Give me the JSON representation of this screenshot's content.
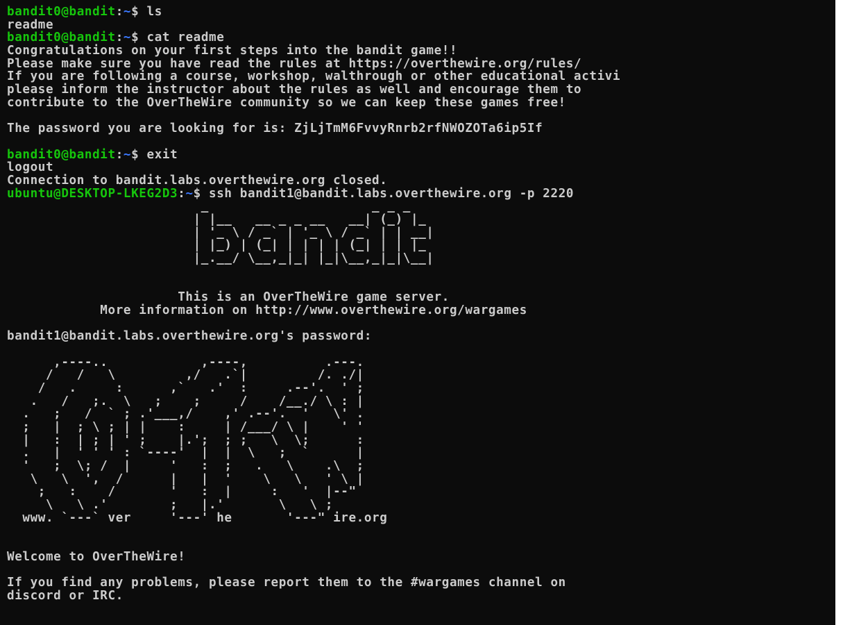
{
  "colors": {
    "background": "#0c0c0c",
    "text": "#cccccc",
    "prompt_user": "#16c60c",
    "prompt_path": "#3b78ff"
  },
  "session": [
    {
      "type": "prompt",
      "user": "bandit0@bandit",
      "sep": ":",
      "path": "~",
      "sign": "$",
      "cmd": " ls"
    },
    {
      "type": "text",
      "text": "readme"
    },
    {
      "type": "prompt",
      "user": "bandit0@bandit",
      "sep": ":",
      "path": "~",
      "sign": "$",
      "cmd": " cat readme"
    },
    {
      "type": "text",
      "text": "Congratulations on your first steps into the bandit game!!"
    },
    {
      "type": "text",
      "text": "Please make sure you have read the rules at https://overthewire.org/rules/"
    },
    {
      "type": "text",
      "text": "If you are following a course, workshop, walthrough or other educational activi"
    },
    {
      "type": "text",
      "text": "please inform the instructor about the rules as well and encourage them to"
    },
    {
      "type": "text",
      "text": "contribute to the OverTheWire community so we can keep these games free!"
    },
    {
      "type": "blank"
    },
    {
      "type": "text",
      "text": "The password you are looking for is: ZjLjTmM6FvvyRnrb2rfNWOZOTa6ip5If"
    },
    {
      "type": "blank"
    },
    {
      "type": "prompt",
      "user": "bandit0@bandit",
      "sep": ":",
      "path": "~",
      "sign": "$",
      "cmd": " exit"
    },
    {
      "type": "text",
      "text": "logout"
    },
    {
      "type": "text",
      "text": "Connection to bandit.labs.overthewire.org closed."
    },
    {
      "type": "prompt",
      "user": "ubuntu@DESKTOP-LKEG2D3",
      "sep": ":",
      "path": "~",
      "sign": "$",
      "cmd": " ssh bandit1@bandit.labs.overthewire.org -p 2220"
    },
    {
      "type": "art",
      "text": "                         _                     _ _ _"
    },
    {
      "type": "art",
      "text": "                        | |__   __ _ _ __   __| (_) |_"
    },
    {
      "type": "art",
      "text": "                        | '_ \\ / _` | '_ \\ / _` | | __|"
    },
    {
      "type": "art",
      "text": "                        | |_) | (_| | | | | (_| | | |_"
    },
    {
      "type": "art",
      "text": "                        |_.__/ \\__,_|_| |_|\\__,_|_|\\__|"
    },
    {
      "type": "blank"
    },
    {
      "type": "blank"
    },
    {
      "type": "text",
      "text": "                      This is an OverTheWire game server."
    },
    {
      "type": "text",
      "text": "            More information on http://www.overthewire.org/wargames"
    },
    {
      "type": "blank"
    },
    {
      "type": "text",
      "text": "bandit1@bandit.labs.overthewire.org's password:"
    },
    {
      "type": "blank"
    },
    {
      "type": "art",
      "text": "      ,----..            ,----,          .---."
    },
    {
      "type": "art",
      "text": "     /   /   \\         ,/   .`|         /. ./|"
    },
    {
      "type": "art",
      "text": "    /   .     :      ,`   .'  :     .--'.  ' ;"
    },
    {
      "type": "art",
      "text": "   .   /   ;.  \\   ;    ;     /    /__./ \\ : |"
    },
    {
      "type": "art",
      "text": "  .   ;   /  ` ; .'___,/    ,' .--'.  '   \\' ."
    },
    {
      "type": "art",
      "text": "  ;   |  ; \\ ; | |    :     | /___/ \\ |    ' '"
    },
    {
      "type": "art",
      "text": "  |   :  | ; | ' ;    |.';  ; ;   \\  \\;      :"
    },
    {
      "type": "art",
      "text": "  .   |  ' ' ' : `----'  |  |  \\   ;  `      |"
    },
    {
      "type": "art",
      "text": "  '   ;  \\; /  |     '   :  ;   .   \\    .\\  ;"
    },
    {
      "type": "art",
      "text": "   \\   \\  ',  /      |   |  '    \\   \\   ' \\ |"
    },
    {
      "type": "art",
      "text": "    ;   :    /       '   :  |     :   '  |--\""
    },
    {
      "type": "art",
      "text": "     \\   \\ .'        ;   |.'       \\   \\ ;"
    },
    {
      "type": "art",
      "text": "  www. `---` ver     '---' he       '---\" ire.org"
    },
    {
      "type": "blank"
    },
    {
      "type": "blank"
    },
    {
      "type": "text",
      "text": "Welcome to OverTheWire!"
    },
    {
      "type": "blank"
    },
    {
      "type": "text",
      "text": "If you find any problems, please report them to the #wargames channel on"
    },
    {
      "type": "text",
      "text": "discord or IRC."
    }
  ]
}
